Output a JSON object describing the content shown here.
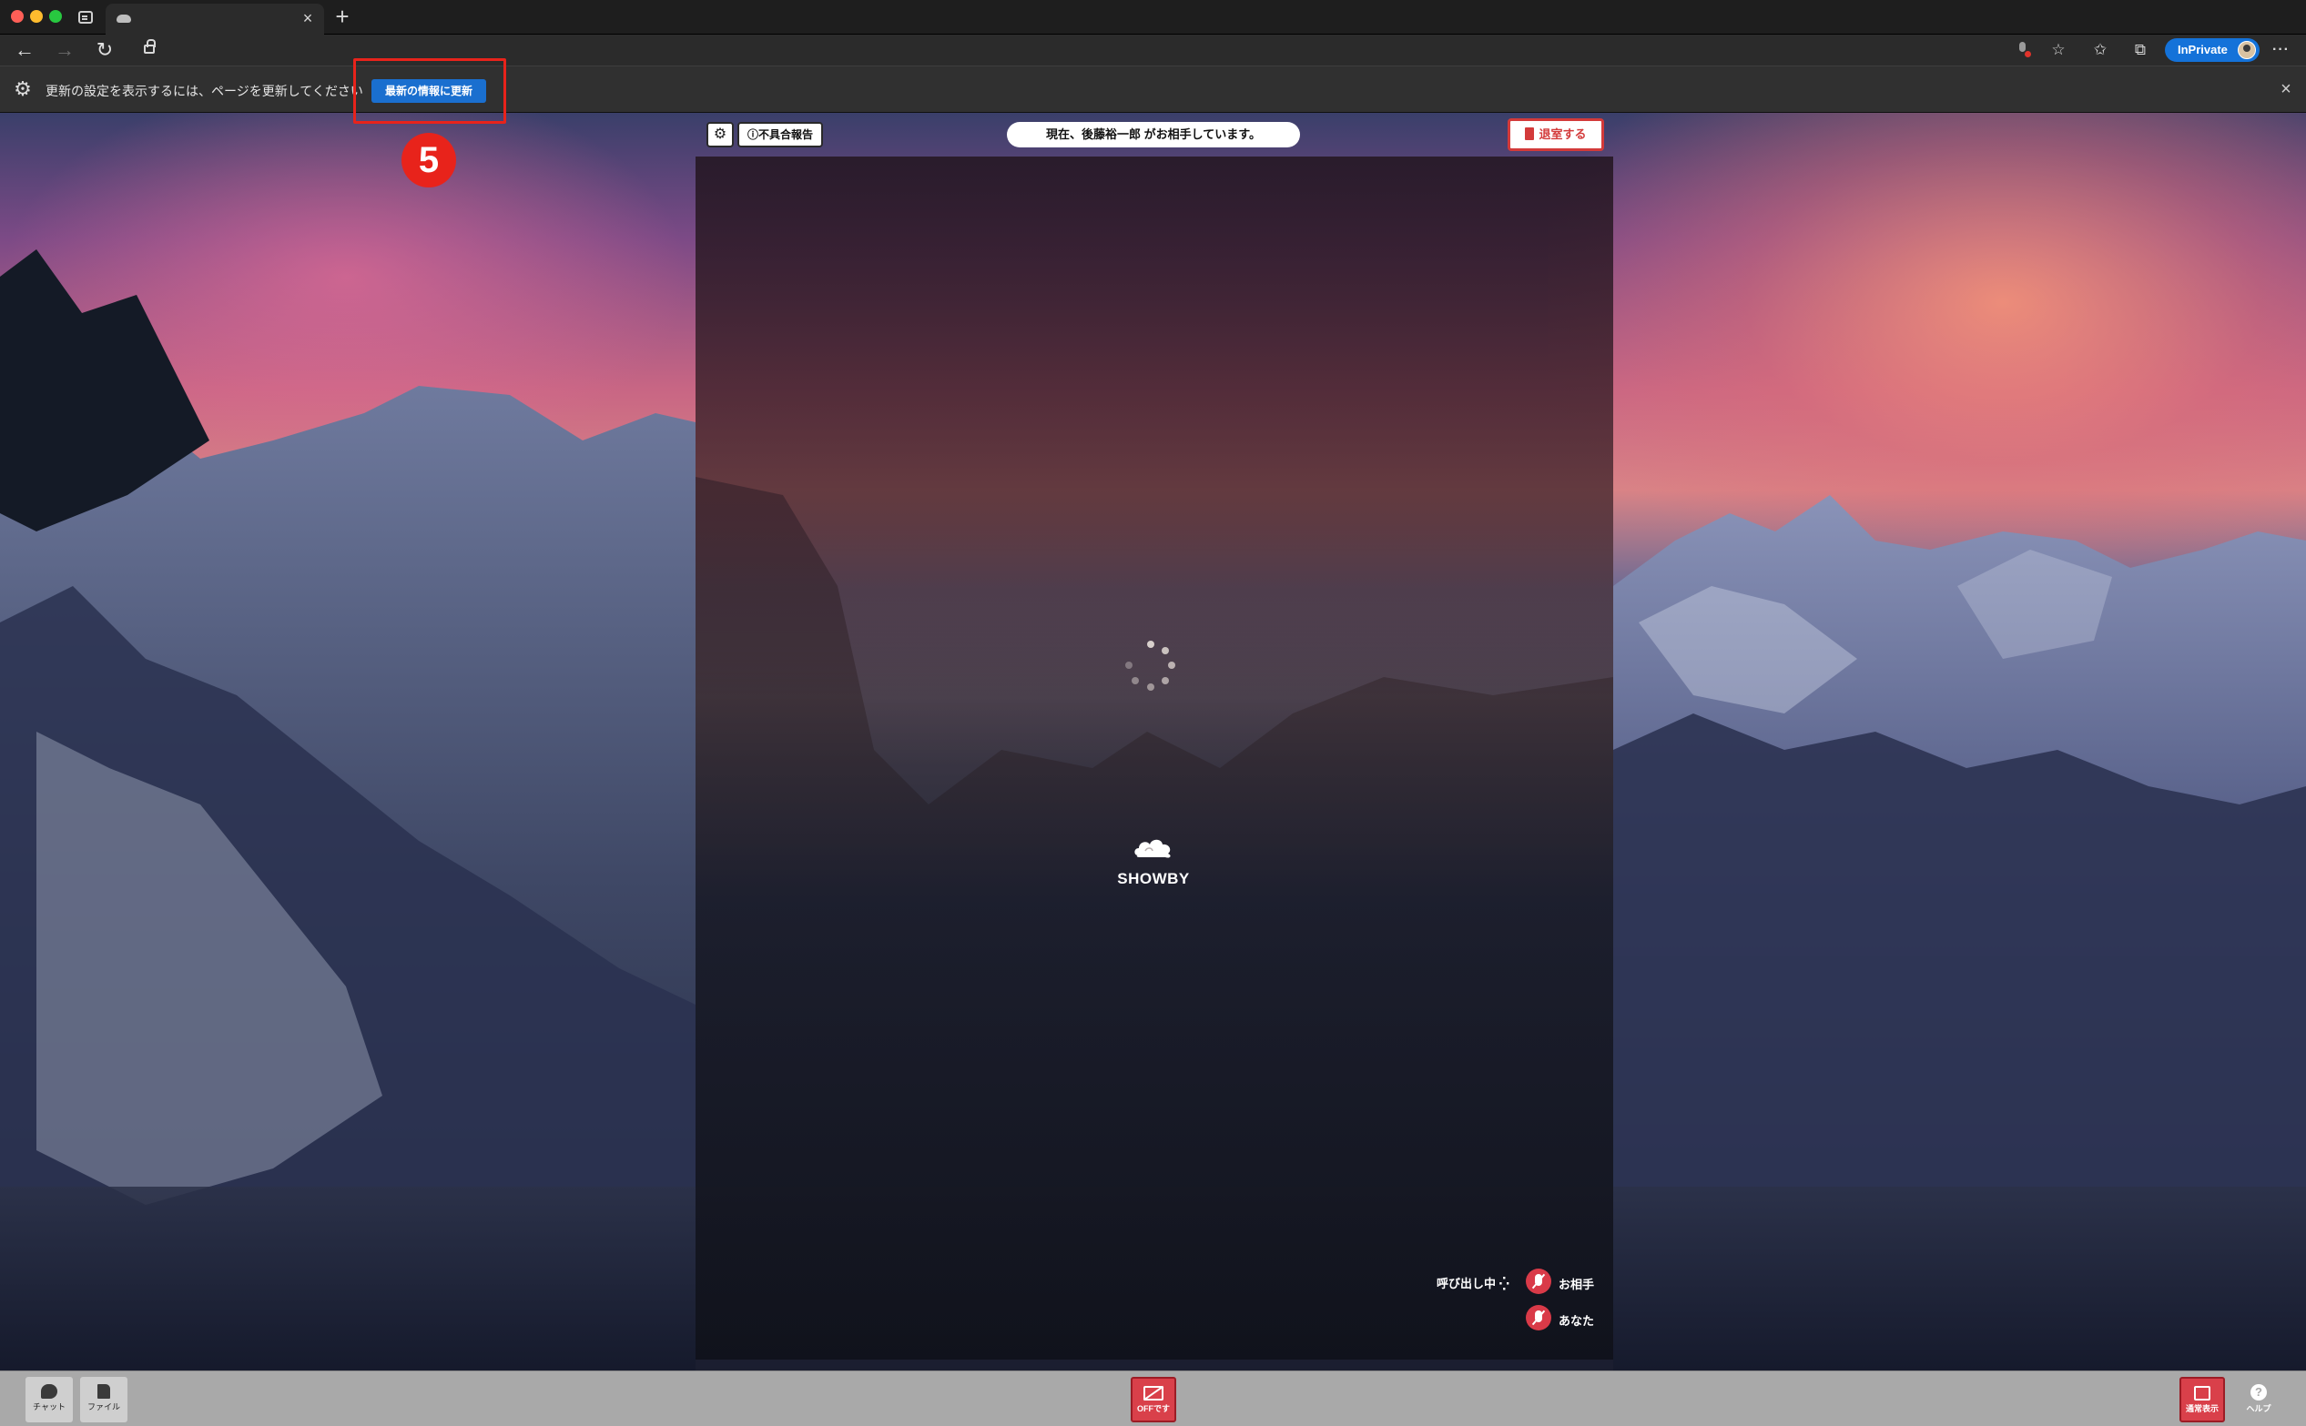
{
  "browser": {
    "tab_close": "×",
    "new_tab": "+",
    "inprivate_label": "InPrivate",
    "more": "···"
  },
  "infobar": {
    "message": "更新の設定を表示するには、ページを更新してください",
    "refresh_button": "最新の情報に更新",
    "close": "×"
  },
  "annotation": {
    "step_number": "5"
  },
  "room": {
    "report_button": "不具合報告",
    "status": "現在、後藤裕一郎 がお相手しています。",
    "leave_button": "退室する",
    "brand": "SHOWBY",
    "calling_status": "呼び出し中",
    "partner_label": "お相手",
    "you_label": "あなた"
  },
  "bottombar": {
    "chat_label": "チャット",
    "file_label": "ファイル",
    "camera_label": "OFFです",
    "normal_view_label": "通常表示",
    "help_label": "ヘルプ"
  },
  "colors": {
    "accent_red": "#e8231b",
    "brand_blue": "#1a6fcf",
    "inprivate_blue": "#1472d9",
    "mute_red": "#d93a48"
  }
}
